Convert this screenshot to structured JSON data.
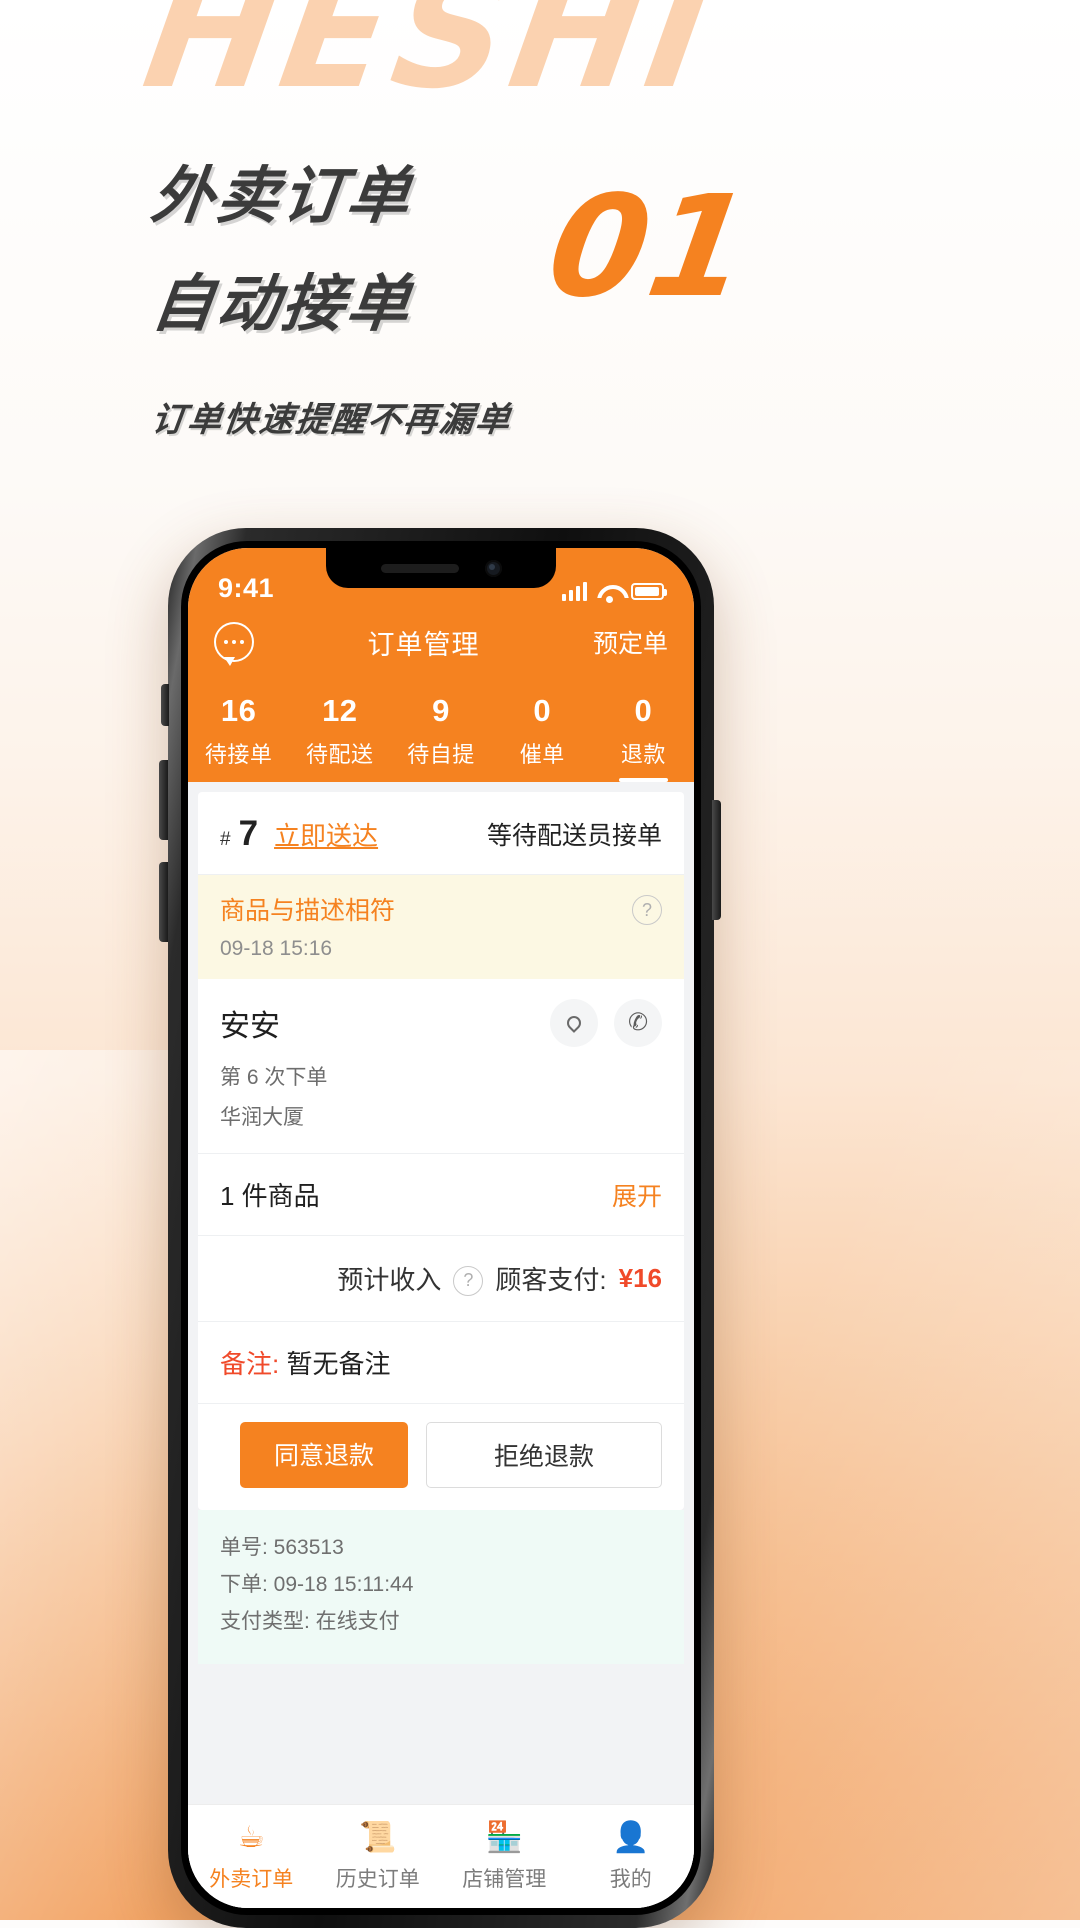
{
  "promo": {
    "watermark": "HESHI",
    "headline_line1": "外卖订单",
    "headline_line2": "自动接单",
    "subtitle": "订单快速提醒不再漏单",
    "step_number": "01",
    "accent_color": "#f58220",
    "watermark_color": "#fbd2b0"
  },
  "statusbar": {
    "time": "9:41",
    "signal_icon": "signal-bars-icon",
    "wifi_icon": "wifi-icon",
    "battery_icon": "battery-icon"
  },
  "navbar": {
    "chat_icon": "chat-bubble-icon",
    "title": "订单管理",
    "right_action": "预定单"
  },
  "tabs": [
    {
      "count": "16",
      "label": "待接单",
      "active": false
    },
    {
      "count": "12",
      "label": "待配送",
      "active": false
    },
    {
      "count": "9",
      "label": "待自提",
      "active": false
    },
    {
      "count": "0",
      "label": "催单",
      "active": false
    },
    {
      "count": "0",
      "label": "退款",
      "active": true
    }
  ],
  "order": {
    "hash_symbol": "#",
    "sequence": "7",
    "delivery_type": "立即送达",
    "status": "等待配送员接单",
    "banner": {
      "title": "商品与描述相符",
      "time": "09-18 15:16",
      "help_icon": "question-mark-icon"
    },
    "customer": {
      "name": "安安",
      "order_count": "第 6 次下单",
      "address": "华润大厦",
      "location_icon": "location-pin-icon",
      "phone_icon": "phone-icon"
    },
    "goods": {
      "summary": "1 件商品",
      "expand_label": "展开"
    },
    "payment": {
      "income_label": "预计收入",
      "income_help_icon": "question-mark-icon",
      "customer_paid_label": "顾客支付:",
      "customer_paid_amount": "¥16"
    },
    "note": {
      "label": "备注:",
      "value": "暂无备注"
    },
    "actions": {
      "approve": "同意退款",
      "reject": "拒绝退款"
    },
    "meta": {
      "order_no": "单号: 563513",
      "placed_at": "下单: 09-18 15:11:44",
      "pay_type": "支付类型: 在线支付"
    }
  },
  "tabbar": [
    {
      "icon": "takeout-cup-icon",
      "label": "外卖订单",
      "active": true
    },
    {
      "icon": "history-book-icon",
      "label": "历史订单",
      "active": false
    },
    {
      "icon": "shop-icon",
      "label": "店铺管理",
      "active": false
    },
    {
      "icon": "person-card-icon",
      "label": "我的",
      "active": false
    }
  ]
}
